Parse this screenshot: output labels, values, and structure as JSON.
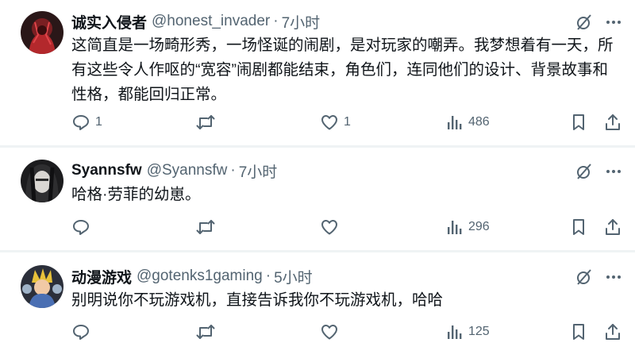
{
  "tweets": [
    {
      "name": "诚实入侵者",
      "handle": "@honest_invader",
      "separator": "·",
      "time": "7小时",
      "text": "这简直是一场畸形秀，一场怪诞的闹剧，是对玩家的嘲弄。我梦想着有一天，所有这些令人作呕的“宽容”闹剧都能结束，角色们，连同他们的设计、背景故事和性格，都能回归正常。",
      "replies": "1",
      "retweets": "",
      "likes": "1",
      "views": "486"
    },
    {
      "name": "Syannsfw",
      "handle": "@Syannsfw",
      "separator": "·",
      "time": "7小时",
      "text": "哈格·劳菲的幼崽。",
      "replies": "",
      "retweets": "",
      "likes": "",
      "views": "296"
    },
    {
      "name": "动漫游戏",
      "handle": "@gotenks1gaming",
      "separator": "·",
      "time": "5小时",
      "text": "别明说你不玩游戏机，直接告诉我你不玩游戏机，哈哈",
      "replies": "",
      "retweets": "",
      "likes": "",
      "views": "125"
    }
  ],
  "icons": {
    "grok": "grok-icon",
    "more": "more-icon",
    "reply": "reply-icon",
    "retweet": "retweet-icon",
    "like": "heart-icon",
    "views": "views-icon",
    "bookmark": "bookmark-icon",
    "share": "share-icon"
  },
  "colors": {
    "text": "#0f1419",
    "secondary": "#536471",
    "divider": "#eff3f4"
  }
}
